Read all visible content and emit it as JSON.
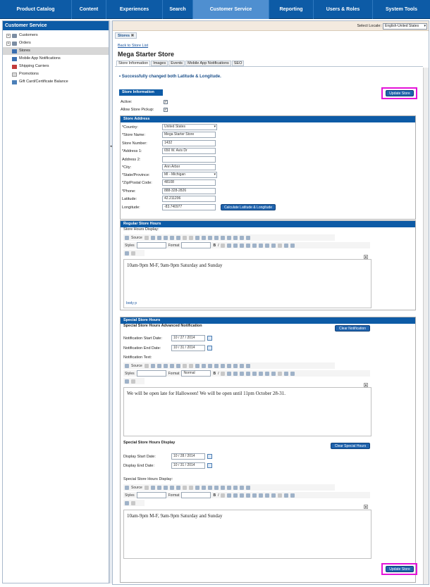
{
  "topnav": {
    "tabs": [
      {
        "label": "Product Catalog"
      },
      {
        "label": "Content"
      },
      {
        "label": "Experiences"
      },
      {
        "label": "Search"
      },
      {
        "label": "Customer Service",
        "active": true
      },
      {
        "label": "Reporting"
      },
      {
        "label": "Users & Roles"
      },
      {
        "label": "System Tools"
      }
    ]
  },
  "sidebar": {
    "title": "Customer Service",
    "items": [
      {
        "label": "Customers",
        "icon": "folder-icon",
        "expandable": true
      },
      {
        "label": "Orders",
        "icon": "folder-icon",
        "expandable": true
      },
      {
        "label": "Stores",
        "icon": "store-icon",
        "active": true
      },
      {
        "label": "Mobile App Notifications",
        "icon": "store-icon"
      },
      {
        "label": "Shipping Carriers",
        "icon": "truck-icon"
      },
      {
        "label": "Promotions",
        "icon": "promotion-icon"
      },
      {
        "label": "Gift Card/Certificate Balance",
        "icon": "gift-icon"
      }
    ]
  },
  "locale": {
    "label": "Select Locale:",
    "value": "English-United States"
  },
  "doc_tab": {
    "label": "Stores"
  },
  "page": {
    "back_link": "Back to Store List",
    "title": "Mega Starter Store",
    "tabs": [
      "Store Information",
      "Images",
      "Events",
      "Mobile App Notifications",
      "SEO"
    ],
    "success": "Successfully changed both Latitude & Longitude."
  },
  "store_info": {
    "header": "Store Information",
    "update_label": "Update Store",
    "active_label": "Active:",
    "pickup_label": "Allow Store Pickup:"
  },
  "address": {
    "header": "Store Address",
    "fields": [
      {
        "label": "*Country:",
        "value": "United States",
        "type": "select"
      },
      {
        "label": "*Store Name:",
        "value": "Mega Starter Store"
      },
      {
        "label": "Store Number:",
        "value": "1432"
      },
      {
        "label": "*Address 1:",
        "value": "650 W. Avis Dr"
      },
      {
        "label": "Address 2:",
        "value": ""
      },
      {
        "label": "*City:",
        "value": "Ann Arbor"
      },
      {
        "label": "*State/Province:",
        "value": "MI - Michigan",
        "type": "select"
      },
      {
        "label": "*Zip/Postal Code:",
        "value": "48108"
      },
      {
        "label": "*Phone:",
        "value": "888-328-2826"
      },
      {
        "label": "Latitude:",
        "value": "42.211206"
      },
      {
        "label": "Longitude:",
        "value": "-83.740977"
      }
    ],
    "calc_label": "Calculate Latitude & Longitude"
  },
  "toolbar": {
    "source": "Source",
    "styles": "Styles",
    "format": "Format",
    "format_value": "Normal"
  },
  "regular_hours": {
    "header": "Regular Store Hours",
    "label": "Store Hours Display:",
    "text": "10am-9pm M-F, 9am-9pm Saturday and Sunday",
    "path": "body p"
  },
  "special_hours": {
    "header": "Special Store Hours",
    "adv_title": "Special Store Hours Advanced Notification",
    "clear_notification": "Clear Notification",
    "notif_start_label": "Notification Start Date:",
    "notif_start": "10 / 27 /  2014",
    "notif_end_label": "Notification End Date:",
    "notif_end": "10 / 31 /  2014",
    "notif_text_label": "Notification Text:",
    "notif_text": "We will be open late for Halloween!  We will be open until 11pm October 28-31.",
    "display_title": "Special Store Hours Display",
    "clear_special": "Clear Special Hours",
    "display_start_label": "Display Start Date:",
    "display_start": "10 / 28 /  2014",
    "display_end_label": "Display End Date:",
    "display_end": "10 / 31 /  2014",
    "display_label": "Special Store Hours Display:",
    "display_text": "10am-9pm M-F, 9am-9pm Saturday and Sunday"
  },
  "bottom": {
    "update_label": "Update Store"
  },
  "colors": {
    "nav": "#0d5ba6",
    "highlight": "#e413d8"
  }
}
